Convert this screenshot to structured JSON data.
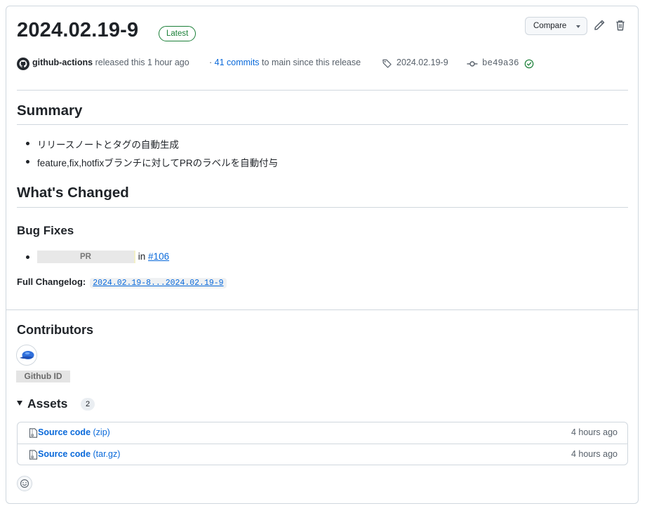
{
  "release": {
    "title": "2024.02.19-9",
    "latest_badge": "Latest",
    "compare_label": "Compare",
    "author": "github-actions",
    "released_text": "released this 1 hour ago",
    "commits_prefix": "·",
    "commits_link": "41 commits",
    "commits_suffix": "to main since this release",
    "tag": "2024.02.19-9",
    "commit_sha": "be49a36"
  },
  "body": {
    "summary_heading": "Summary",
    "summary_items": [
      "リリースノートとタグの自動生成",
      "feature,fix,hotfixブランチに対してPRのラベルを自動付与"
    ],
    "changed_heading": "What's Changed",
    "bugfix_heading": "Bug Fixes",
    "bugfix_pr_placeholder": "PR",
    "bugfix_in": "in",
    "bugfix_pr_link": "#106",
    "full_changelog_label": "Full Changelog:",
    "full_changelog_link": "2024.02.19-8...2024.02.19-9"
  },
  "contributors": {
    "heading": "Contributors",
    "user_label": "Github ID"
  },
  "assets": {
    "heading": "Assets",
    "count": "2",
    "items": [
      {
        "name": "Source code",
        "ext": "(zip)",
        "time": "4 hours ago"
      },
      {
        "name": "Source code",
        "ext": "(tar.gz)",
        "time": "4 hours ago"
      }
    ]
  },
  "icons": {
    "pencil": "pencil-icon",
    "trash": "trash-icon",
    "tag": "tag-icon",
    "commit": "git-commit-icon",
    "verified": "check-circle-icon",
    "zip": "file-zip-icon",
    "smiley": "smiley-icon"
  },
  "colors": {
    "link": "#0969da",
    "success": "#1a7f37",
    "border": "#d0d7de",
    "muted_text": "#57606a"
  }
}
